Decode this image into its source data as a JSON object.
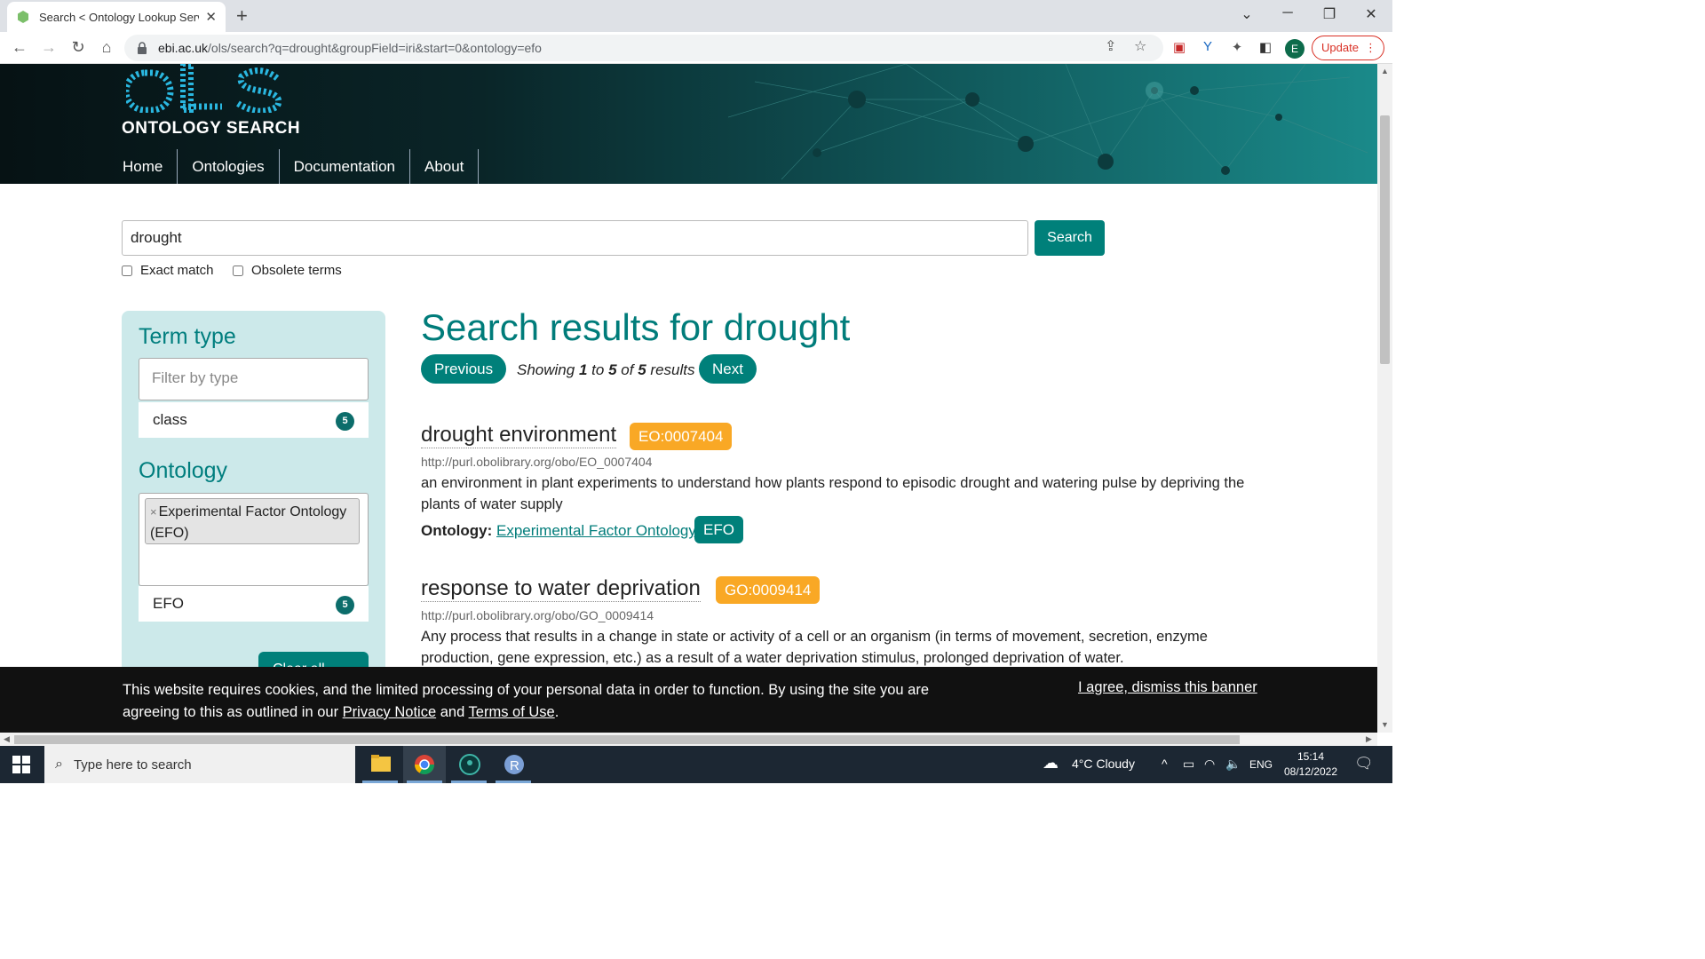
{
  "browser": {
    "tab_title": "Search < Ontology Lookup Servi",
    "url_host": "ebi.ac.uk",
    "url_path": "/ols/search?q=drought&groupField=iri&start=0&ontology=efo",
    "profile_initial": "E",
    "update_label": "Update"
  },
  "header": {
    "brand": "ONTOLOGY SEARCH",
    "nav": [
      "Home",
      "Ontologies",
      "Documentation",
      "About"
    ]
  },
  "search": {
    "query": "drought",
    "button": "Search",
    "exact_match": "Exact match",
    "obsolete_terms": "Obsolete terms"
  },
  "sidebar": {
    "term_type_heading": "Term type",
    "filter_placeholder": "Filter by type",
    "term_facets": [
      {
        "label": "class",
        "count": "5"
      }
    ],
    "ontology_heading": "Ontology",
    "selected_ontology": "Experimental Factor Ontology (EFO)",
    "ontology_facets": [
      {
        "label": "EFO",
        "count": "5"
      }
    ],
    "clear_button": "Clear all filters"
  },
  "results": {
    "heading": "Search results for drought",
    "previous": "Previous",
    "next": "Next",
    "showing_prefix": "Showing",
    "showing_from": "1",
    "showing_to_word": "to",
    "showing_to": "5",
    "showing_of_word": "of",
    "showing_total": "5",
    "showing_suffix": "results",
    "items": [
      {
        "title": "drought environment",
        "id": "EO:0007404",
        "iri": "http://purl.obolibrary.org/obo/EO_0007404",
        "description": "an environment in plant experiments to understand how plants respond to episodic drought and watering pulse by depriving the plants of water supply",
        "ontology_label": "Ontology:",
        "ontology_name": "Experimental Factor Ontology",
        "ontology_badge": "EFO"
      },
      {
        "title": "response to water deprivation",
        "id": "GO:0009414",
        "iri": "http://purl.obolibrary.org/obo/GO_0009414",
        "description": "Any process that results in a change in state or activity of a cell or an organism (in terms of movement, secretion, enzyme production, gene expression, etc.) as a result of a water deprivation stimulus, prolonged deprivation of water."
      }
    ]
  },
  "cookie": {
    "text_1": "This website requires cookies, and the limited processing of your personal data in order to function. By using the site you are agreeing to this as outlined in our",
    "privacy_link": "Privacy Notice",
    "and": "and",
    "terms_link": "Terms of Use",
    "period": ".",
    "agree": "I agree, dismiss this banner"
  },
  "taskbar": {
    "search_placeholder": "Type here to search",
    "weather": "4°C  Cloudy",
    "lang": "ENG",
    "time": "15:14",
    "date": "08/12/2022"
  },
  "colors": {
    "accent": "#00807a",
    "heading_teal": "#007c7a",
    "badge_orange": "#f9a825",
    "sidebar_bg": "#cce9ea"
  }
}
